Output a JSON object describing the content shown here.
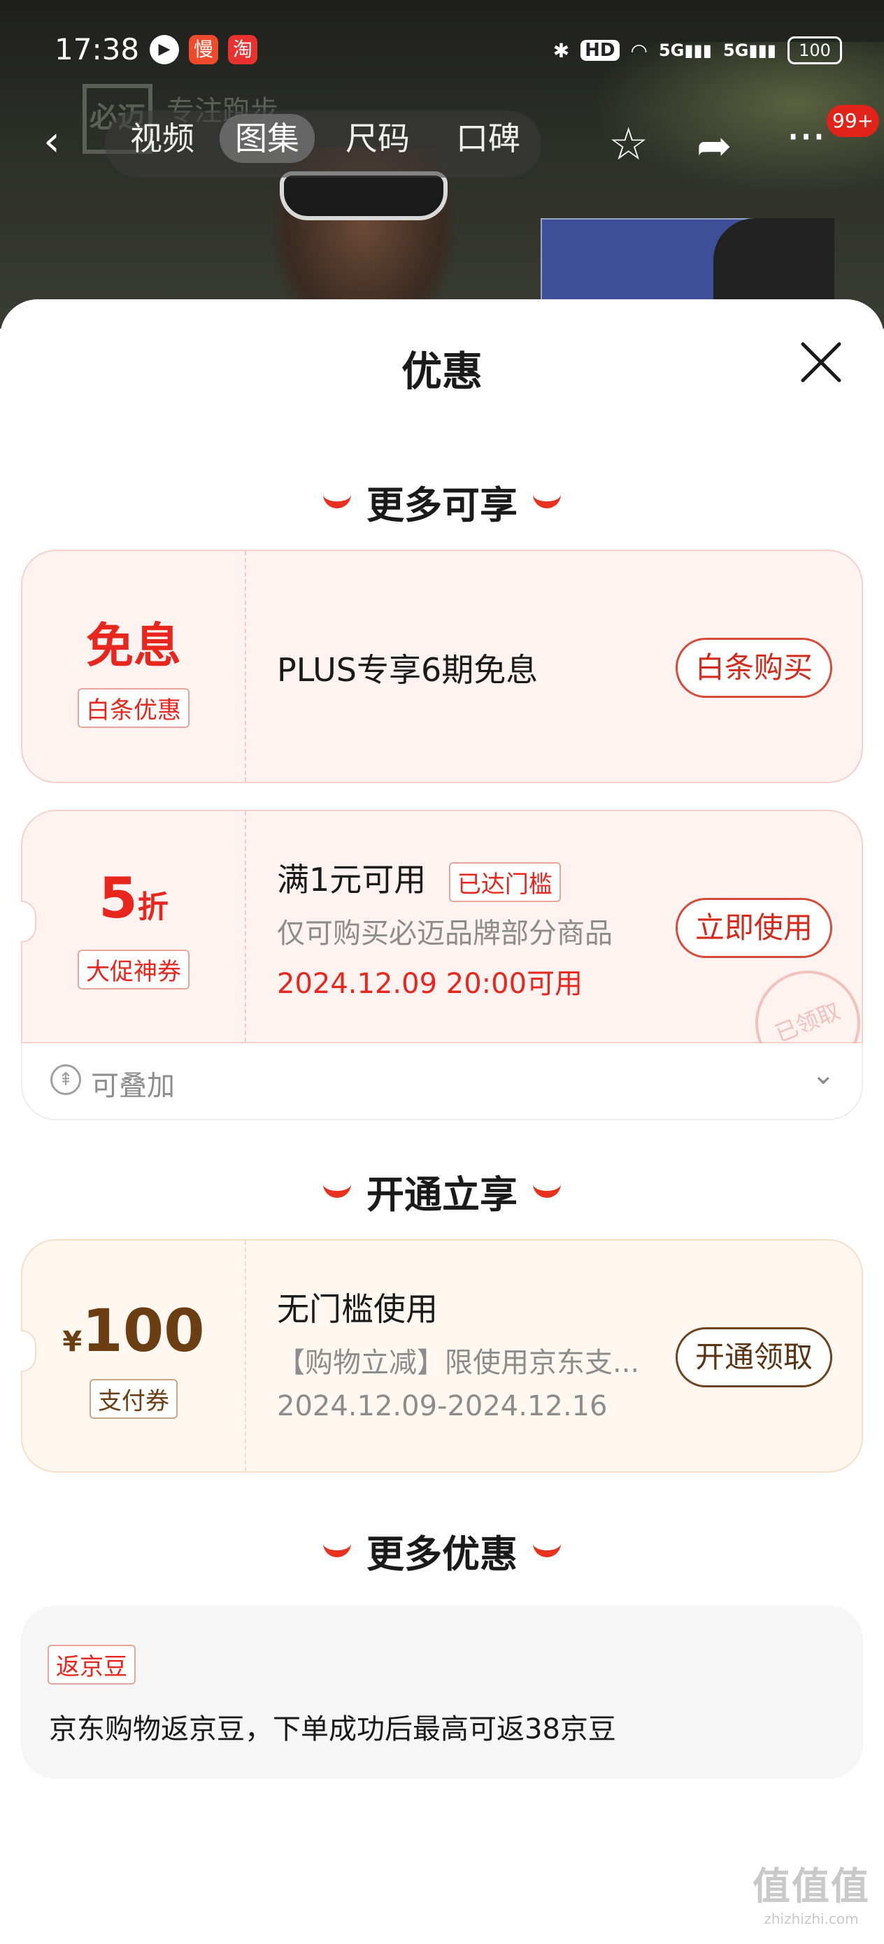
{
  "status_bar": {
    "time": "17:38",
    "play_icon": "▶",
    "app_man": "慢",
    "app_tao": "淘",
    "bluetooth": "✱",
    "hd": "HD",
    "wifi": "◠",
    "signal1": "5G▮▮▮",
    "signal2": "5G▮▮▮",
    "battery": "100"
  },
  "brand": {
    "logo": "必迈",
    "text": "专注跑步"
  },
  "nav": {
    "back": "‹",
    "tabs": [
      "视频",
      "图集",
      "尺码",
      "口碑"
    ],
    "active_tab": "图集",
    "star": "☆",
    "share": "➦",
    "more": "···",
    "badge": "99+"
  },
  "sheet": {
    "title": "优惠",
    "sections": {
      "more_available": "更多可享",
      "open_enjoy": "开通立享",
      "more_offers": "更多优惠"
    }
  },
  "cards": {
    "baitiao": {
      "left_main": "免息",
      "left_tag": "白条优惠",
      "main_text": "PLUS专享6期免息",
      "button": "白条购买"
    },
    "discount": {
      "left_value": "5",
      "left_unit": "折",
      "left_tag": "大促神券",
      "main_text": "满1元可用",
      "threshold_tag": "已达门槛",
      "sub_text": "仅可购买必迈品牌部分商品",
      "date_text": "2024.12.09 20:00可用",
      "button": "立即使用",
      "stamp": "已领取",
      "stack_label": "可叠加",
      "stack_icon": "⇞",
      "chevron": "⌄"
    },
    "payment": {
      "currency": "¥",
      "amount": "100",
      "left_tag": "支付券",
      "main_text": "无门槛使用",
      "sub_text": "【购物立减】限使用京东支...",
      "date_text": "2024.12.09-2024.12.16",
      "button": "开通领取"
    },
    "jingdou": {
      "tag": "返京豆",
      "text": "京东购物返京豆，下单成功后最高可返38京豆"
    }
  },
  "watermark": {
    "main": "值值值",
    "sub": "zhizhizhi.com"
  },
  "colors": {
    "accent_red": "#e8261d",
    "card_pink": "#fff3f1",
    "card_gold": "#fff7f0",
    "brown": "#6b3e14"
  }
}
